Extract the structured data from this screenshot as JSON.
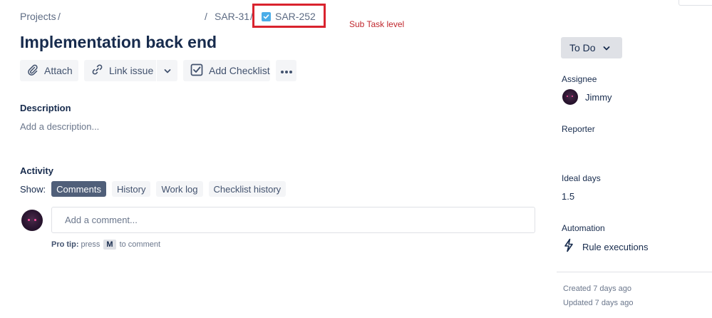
{
  "breadcrumb": {
    "projects": "Projects",
    "sep1": "/",
    "sep2": "/",
    "parent": "SAR-31",
    "sep3": "/",
    "current": "SAR-252",
    "current_icon": "subtask-checkbox-icon"
  },
  "annotation": "Sub Task level",
  "issue": {
    "title": "Implementation back end"
  },
  "toolbar": {
    "attach": "Attach",
    "link_issue": "Link issue",
    "add_checklist": "Add Checklist"
  },
  "description": {
    "label": "Description",
    "placeholder": "Add a description..."
  },
  "activity": {
    "label": "Activity",
    "show_label": "Show:",
    "filters": [
      "Comments",
      "History",
      "Work log",
      "Checklist history"
    ],
    "active_filter": "Comments"
  },
  "comment": {
    "placeholder": "Add a comment...",
    "protip_prefix": "Pro tip:",
    "protip_press": "press",
    "protip_key": "M",
    "protip_suffix": "to comment"
  },
  "sidebar": {
    "status": "To Do",
    "assignee_label": "Assignee",
    "assignee": "Jimmy",
    "reporter_label": "Reporter",
    "ideal_days_label": "Ideal days",
    "ideal_days": "1.5",
    "automation_label": "Automation",
    "rule_executions": "Rule executions",
    "created": "Created 7 days ago",
    "updated": "Updated 7 days ago"
  },
  "colors": {
    "highlight_box": "#d9232e",
    "annotation_text": "#c0272d",
    "active_filter_bg": "#505f79",
    "subtask_icon": "#4bade8"
  }
}
